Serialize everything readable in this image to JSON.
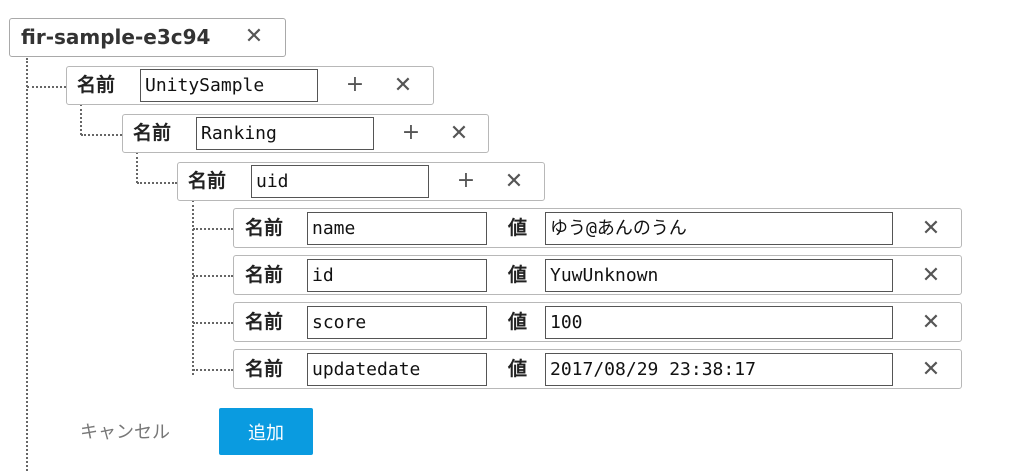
{
  "root": {
    "title": "fir-sample-e3c94",
    "close_glyph": "✕"
  },
  "name_label": "名前",
  "value_label": "値",
  "add_glyph": "+",
  "close_glyph": "✕",
  "nodes": [
    {
      "name": "UnitySample"
    },
    {
      "name": "Ranking"
    },
    {
      "name": "uid"
    }
  ],
  "leaves": [
    {
      "name": "name",
      "value": "ゆう@あんのうん"
    },
    {
      "name": "id",
      "value": "YuwUnknown"
    },
    {
      "name": "score",
      "value": "100"
    },
    {
      "name": "updatedate",
      "value": "2017/08/29 23:38:17"
    }
  ],
  "actions": {
    "cancel_label": "キャンセル",
    "add_label": "追加"
  },
  "colors": {
    "accent": "#0a9be0"
  }
}
